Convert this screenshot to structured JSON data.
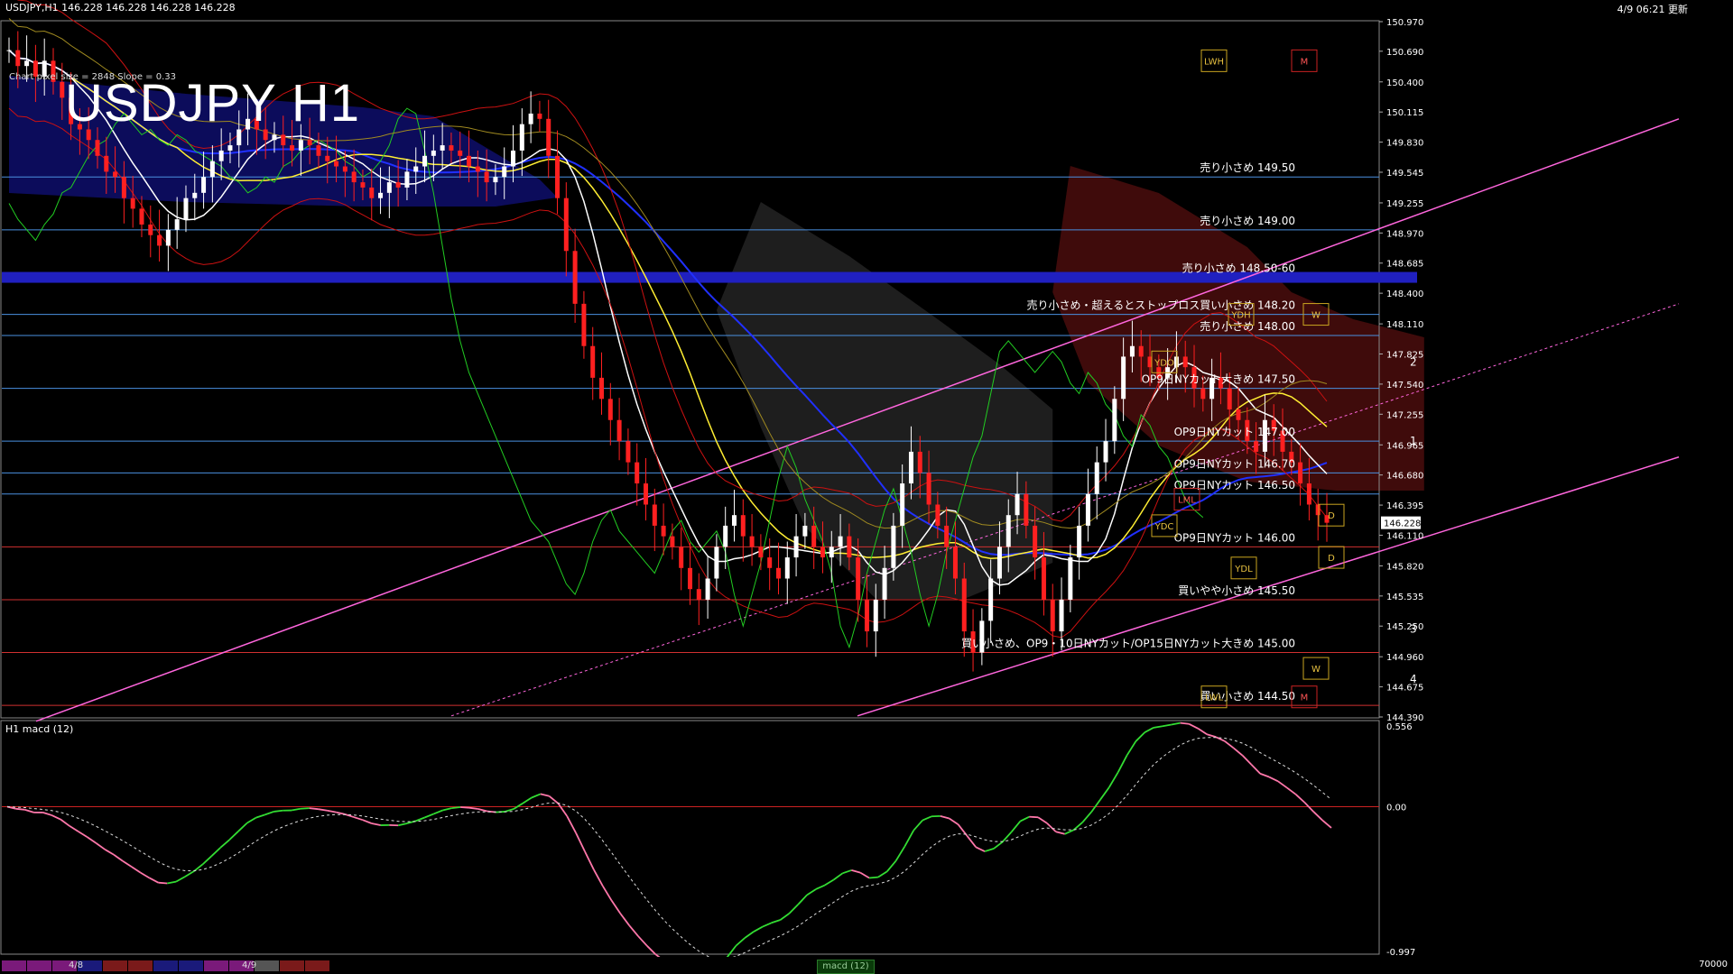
{
  "header": {
    "symbol_info": "USDJPY,H1  146.228 146.228 146.228 146.228",
    "timestamp": "4/9 06:21 更新",
    "title": "USDJPY H1",
    "settings_text": "Chart pixel size = 2848 Slope = 0.33"
  },
  "macd_panel": {
    "title": "H1  macd (12)",
    "tab_label": "macd (12)",
    "volume_label": "70000",
    "axis_labels": [
      "0.556",
      "0.00",
      "-0.997"
    ]
  },
  "bottom_bar": {
    "date_labels": [
      "4/8",
      "4/9"
    ],
    "colors": [
      "#7a1a7a",
      "#7a1a7a",
      "#7a1a7a",
      "#1a1a7a",
      "#7a1a1a",
      "#7a1a1a",
      "#1a1a7a",
      "#1a1a7a",
      "#7a1a7a",
      "#7a1a7a",
      "#555555",
      "#7a1a1a",
      "#7a1a1a"
    ]
  },
  "chart_data": {
    "type": "candlestick",
    "symbol": "USDJPY",
    "timeframe": "H1",
    "current_price": 146.228,
    "price_axis": {
      "min": 144.39,
      "max": 150.97,
      "tick_labels": [
        "150.970",
        "150.690",
        "150.400",
        "150.115",
        "149.830",
        "149.545",
        "149.255",
        "148.970",
        "148.685",
        "148.400",
        "148.110",
        "147.825",
        "147.540",
        "147.255",
        "146.965",
        "146.680",
        "146.395",
        "146.110",
        "145.820",
        "145.535",
        "145.250",
        "144.960",
        "144.675",
        "144.390"
      ]
    },
    "levels": [
      {
        "price": 149.5,
        "label": "売り小さめ 149.50",
        "color": "#4a90e0"
      },
      {
        "price": 149.0,
        "label": "売り小さめ 149.00",
        "color": "#4a90e0"
      },
      {
        "price": 148.55,
        "label": "売り小さめ 148.50-60",
        "color": "#2020c0",
        "band": true
      },
      {
        "price": 148.2,
        "label": "売り小さめ・超えるとストップロス買い小さめ 148.20",
        "color": "#4a90e0"
      },
      {
        "price": 148.0,
        "label": "売り小さめ 148.00",
        "color": "#4a90e0"
      },
      {
        "price": 147.5,
        "label": "OP9日NYカット大きめ 147.50",
        "color": "#4a90e0"
      },
      {
        "price": 147.0,
        "label": "OP9日NYカット 147.00",
        "color": "#4a90e0"
      },
      {
        "price": 146.7,
        "label": "OP9日NYカット 146.70",
        "color": "#4a90e0"
      },
      {
        "price": 146.5,
        "label": "OP9日NYカット 146.50",
        "color": "#4a90e0"
      },
      {
        "price": 146.0,
        "label": "OP9日NYカット 146.00",
        "color": "#d03030"
      },
      {
        "price": 145.5,
        "label": "買いやや小さめ 145.50",
        "color": "#d03030"
      },
      {
        "price": 145.0,
        "label": "買い小さめ、OP9・10日NYカット/OP15日NYカット大きめ 145.00",
        "color": "#d03030"
      },
      {
        "price": 144.5,
        "label": "買い小さめ 144.50",
        "color": "#d03030"
      }
    ],
    "markers": [
      {
        "label": "LWH",
        "price": 150.6
      },
      {
        "label": "M",
        "price": 150.6
      },
      {
        "label": "YDH",
        "price": 148.2
      },
      {
        "label": "W",
        "price": 148.2
      },
      {
        "label": "YDO",
        "price": 147.75
      },
      {
        "label": "LML",
        "price": 146.45
      },
      {
        "label": "YDC",
        "price": 146.2
      },
      {
        "label": "D",
        "price": 146.3
      },
      {
        "label": "D",
        "price": 145.9
      },
      {
        "label": "YDL",
        "price": 145.8
      },
      {
        "label": "W",
        "price": 144.85
      },
      {
        "label": "LWL",
        "price": 144.58
      },
      {
        "label": "M",
        "price": 144.58
      }
    ],
    "wave_labels": [
      {
        "label": "1",
        "price": 147.0
      },
      {
        "label": "2",
        "price": 147.75
      },
      {
        "label": "3",
        "price": 145.22
      },
      {
        "label": "4",
        "price": 144.75
      }
    ],
    "close": [
      150.7,
      150.55,
      150.6,
      150.45,
      150.6,
      150.4,
      150.25,
      150.0,
      149.95,
      149.85,
      149.7,
      149.55,
      149.5,
      149.3,
      149.2,
      149.05,
      148.95,
      148.85,
      149.0,
      149.1,
      149.3,
      149.35,
      149.5,
      149.65,
      149.75,
      149.8,
      149.95,
      150.05,
      149.95,
      149.85,
      149.9,
      149.8,
      149.75,
      149.85,
      149.8,
      149.7,
      149.65,
      149.6,
      149.55,
      149.45,
      149.4,
      149.3,
      149.35,
      149.45,
      149.4,
      149.55,
      149.6,
      149.7,
      149.75,
      149.8,
      149.75,
      149.7,
      149.6,
      149.55,
      149.45,
      149.5,
      149.6,
      149.75,
      150.0,
      150.1,
      150.05,
      149.7,
      149.3,
      148.8,
      148.3,
      147.9,
      147.6,
      147.4,
      147.2,
      147.0,
      146.8,
      146.6,
      146.4,
      146.2,
      146.1,
      146.0,
      145.8,
      145.6,
      145.5,
      145.7,
      146.0,
      146.2,
      146.3,
      146.1,
      146.0,
      145.9,
      145.8,
      145.7,
      145.9,
      146.1,
      146.2,
      146.0,
      145.9,
      146.0,
      146.1,
      145.9,
      145.5,
      145.2,
      145.5,
      145.8,
      146.2,
      146.6,
      146.9,
      146.7,
      146.4,
      146.2,
      146.0,
      145.7,
      145.2,
      145.0,
      145.3,
      145.7,
      146.0,
      146.3,
      146.5,
      146.2,
      145.9,
      145.5,
      145.2,
      145.5,
      145.9,
      146.2,
      146.5,
      146.8,
      147.0,
      147.4,
      147.8,
      147.9,
      147.8,
      147.7,
      147.6,
      147.7,
      147.8,
      147.7,
      147.5,
      147.4,
      147.6,
      147.5,
      147.3,
      147.2,
      147.0,
      146.9,
      147.2,
      147.1,
      146.9,
      146.8,
      146.6,
      146.4,
      146.3,
      146.228
    ],
    "macd": {
      "zero": 0.0,
      "min": -0.997,
      "max": 0.556
    }
  }
}
